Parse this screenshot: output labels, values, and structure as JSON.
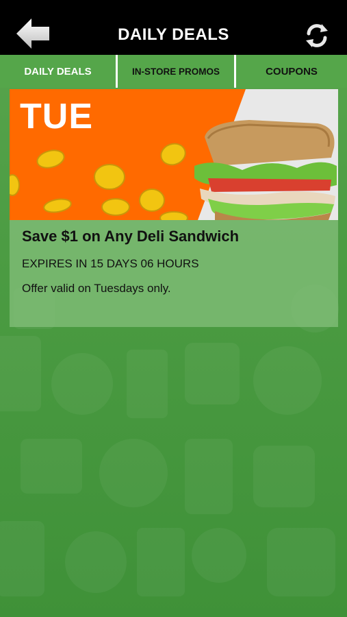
{
  "header": {
    "title": "DAILY DEALS",
    "back_icon": "back-arrow-icon",
    "refresh_icon": "refresh-icon"
  },
  "tabs": [
    {
      "label": "DAILY DEALS",
      "active": true
    },
    {
      "label": "IN-STORE PROMOS",
      "active": false
    },
    {
      "label": "COUPONS",
      "active": false
    }
  ],
  "deal": {
    "day": "TUE",
    "title": "Save $1 on Any Deli Sandwich",
    "expiry": "EXPIRES IN 15 DAYS 06 HOURS",
    "terms": "Offer valid on Tuesdays only."
  },
  "colors": {
    "topbar": "#000000",
    "tab_bg": "#55a64a",
    "banner_orange": "#ff6a00",
    "background_green": "#4c9c43"
  }
}
